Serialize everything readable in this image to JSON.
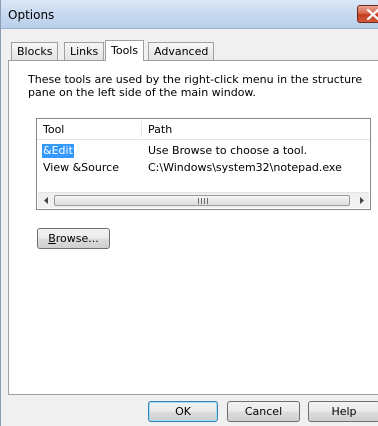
{
  "window": {
    "title": "Options"
  },
  "tabs": [
    {
      "label": "Blocks",
      "active": false
    },
    {
      "label": "Links",
      "active": false
    },
    {
      "label": "Tools",
      "active": true
    },
    {
      "label": "Advanced",
      "active": false
    }
  ],
  "tools_tab": {
    "description": "These tools are used by the right-click menu in the structure pane on the left side of the main window.",
    "columns": [
      "Tool",
      "Path"
    ],
    "rows": [
      {
        "tool": "&Edit",
        "path": "Use Browse to choose a tool.",
        "selected": true
      },
      {
        "tool": "View &Source",
        "path": "C:\\Windows\\system32\\notepad.exe",
        "selected": false
      }
    ],
    "browse_label_accel": "B",
    "browse_label_rest": "rowse..."
  },
  "buttons": {
    "ok": "OK",
    "cancel": "Cancel",
    "help": "Help"
  },
  "icons": {
    "close": "close-icon",
    "scroll_left": "arrow-left-icon",
    "scroll_right": "arrow-right-icon",
    "scroll_grip": "grip-icon"
  },
  "colors": {
    "selection": "#3399ff",
    "close_button": "#c23b1d",
    "titlebar": "#c8daf0",
    "default_button_border": "#3c7fb1"
  }
}
